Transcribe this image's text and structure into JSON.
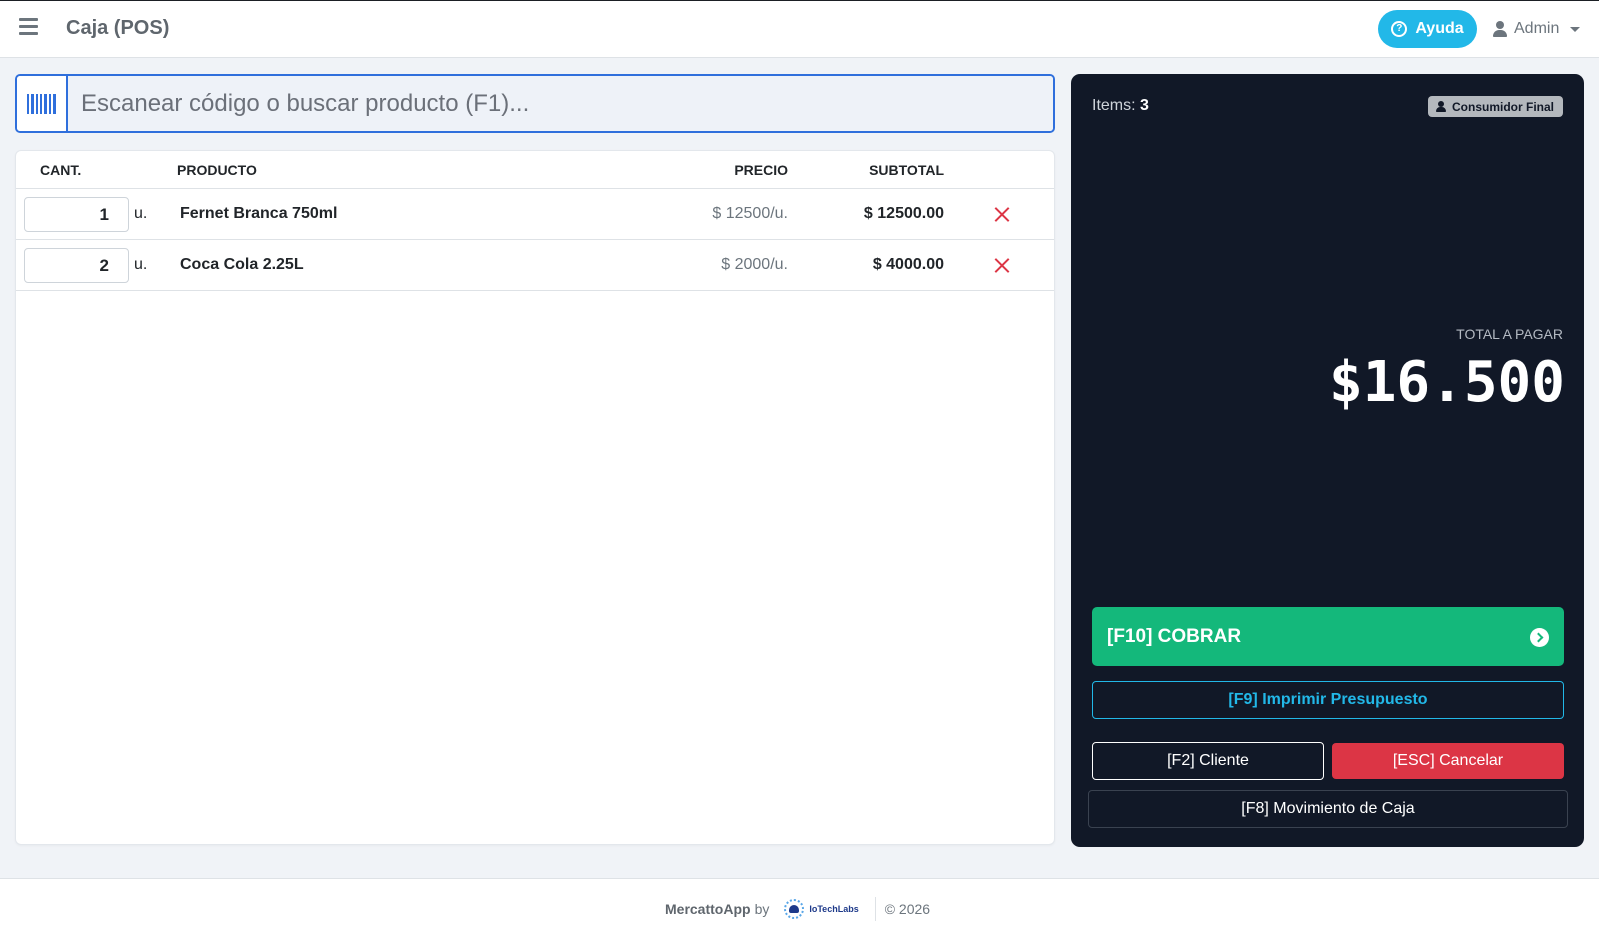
{
  "header": {
    "title": "Caja (POS)",
    "help_label": "Ayuda",
    "user_label": "Admin"
  },
  "search": {
    "placeholder": "Escanear código o buscar producto (F1)..."
  },
  "cart": {
    "columns": {
      "qty": "CANT.",
      "product": "PRODUCTO",
      "price": "PRECIO",
      "subtotal": "SUBTOTAL"
    },
    "rows": [
      {
        "qty": "1",
        "unit": "u.",
        "product": "Fernet Branca 750ml",
        "price": "$ 12500/u.",
        "subtotal": "$ 12500.00"
      },
      {
        "qty": "2",
        "unit": "u.",
        "product": "Coca Cola 2.25L",
        "price": "$ 2000/u.",
        "subtotal": "$ 4000.00"
      }
    ]
  },
  "summary": {
    "items_label": "Items:",
    "items_count": "3",
    "customer": "Consumidor Final",
    "total_label": "TOTAL A PAGAR",
    "total_amount": "$16.500",
    "charge_label": "[F10] COBRAR",
    "quote_label": "[F9] Imprimir Presupuesto",
    "client_label": "[F2] Cliente",
    "cancel_label": "[ESC] Cancelar",
    "cash_movement_label": "[F8] Movimiento de Caja"
  },
  "footer": {
    "brand": "MercattoApp",
    "by": "by",
    "logo_text": "IoTechLabs",
    "copyright": "© 2026"
  },
  "colors": {
    "primary": "#2f6fdc",
    "info": "#22b8e8",
    "success": "#14b87b",
    "danger": "#dc3545",
    "dark_panel": "#111827"
  }
}
